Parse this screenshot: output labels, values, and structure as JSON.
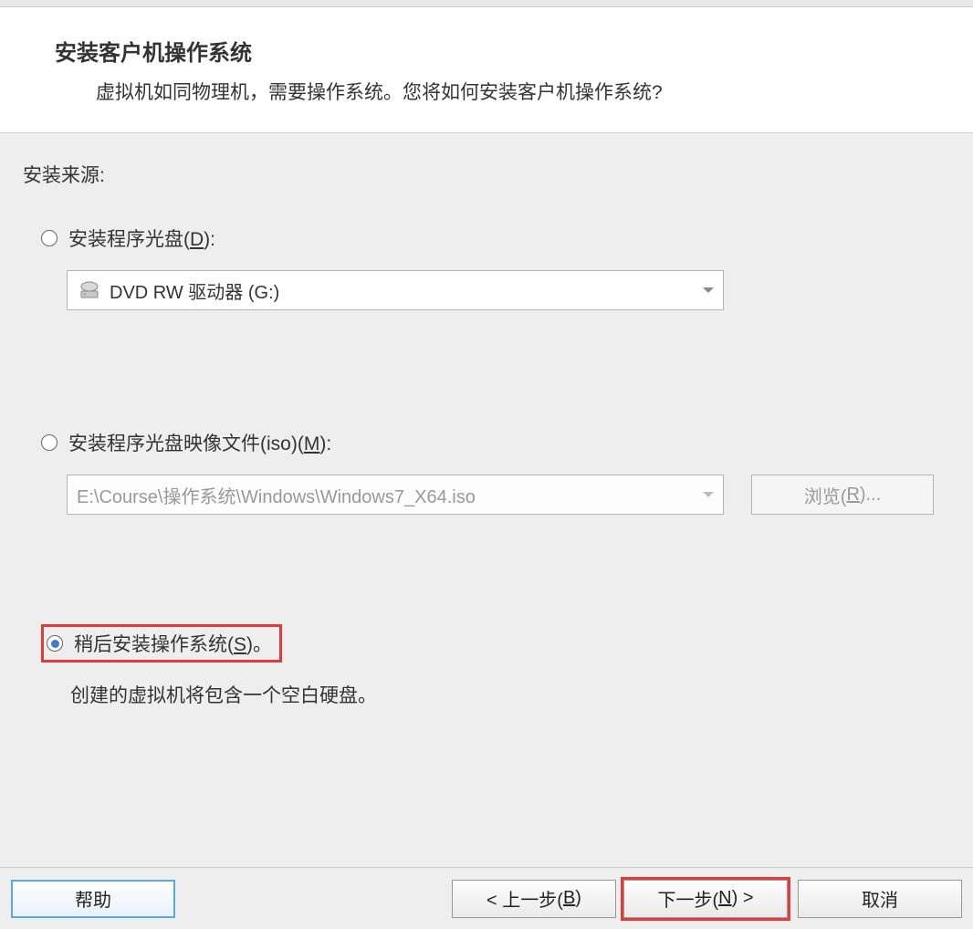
{
  "header": {
    "title": "安装客户机操作系统",
    "subtitle": "虚拟机如同物理机，需要操作系统。您将如何安装客户机操作系统?"
  },
  "source": {
    "section_label": "安装来源:",
    "option1": {
      "label_pre": "安装程序光盘(",
      "label_key": "D",
      "label_post": "):",
      "dropdown_value": "DVD RW 驱动器 (G:)",
      "selected": false
    },
    "option2": {
      "label_pre": "安装程序光盘映像文件(iso)(",
      "label_key": "M",
      "label_post": "):",
      "dropdown_value": "E:\\Course\\操作系统\\Windows\\Windows7_X64.iso",
      "browse_pre": "浏览(",
      "browse_key": "R",
      "browse_post": ")...",
      "selected": false
    },
    "option3": {
      "label_pre": "稍后安装操作系统(",
      "label_key": "S",
      "label_post": ")。",
      "description": "创建的虚拟机将包含一个空白硬盘。",
      "selected": true
    }
  },
  "footer": {
    "help": "帮助",
    "back_pre": "< 上一步(",
    "back_key": "B",
    "back_post": ")",
    "next_pre": "下一步(",
    "next_key": "N",
    "next_post": ") >",
    "cancel": "取消"
  }
}
